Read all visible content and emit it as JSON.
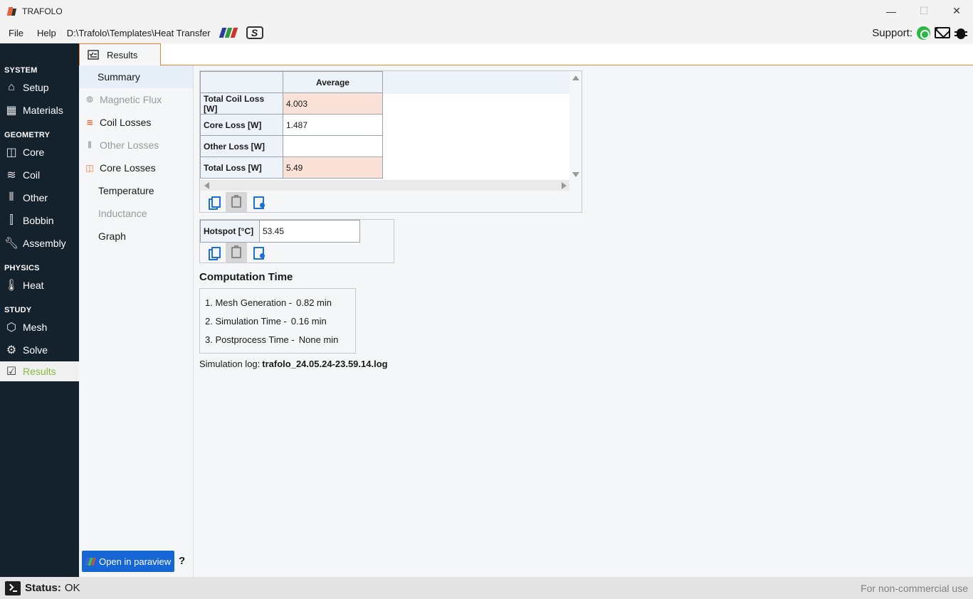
{
  "window": {
    "title": "TRAFOLO",
    "minimize": "—",
    "maximize": "☐",
    "close": "✕"
  },
  "menu": {
    "file": "File",
    "help": "Help",
    "path": "D:\\Trafolo\\Templates\\Heat Transfer",
    "support_label": "Support:"
  },
  "tabs": [
    {
      "label": "Results",
      "icon": "results-icon"
    }
  ],
  "sidebar": {
    "sections": [
      {
        "title": "SYSTEM",
        "items": [
          {
            "label": "Setup",
            "icon": "home-icon"
          },
          {
            "label": "Materials",
            "icon": "materials-icon"
          }
        ]
      },
      {
        "title": "GEOMETRY",
        "items": [
          {
            "label": "Core",
            "icon": "core-icon"
          },
          {
            "label": "Coil",
            "icon": "coil-icon"
          },
          {
            "label": "Other",
            "icon": "other-icon"
          },
          {
            "label": "Bobbin",
            "icon": "bobbin-icon"
          },
          {
            "label": "Assembly",
            "icon": "wrench-icon"
          }
        ]
      },
      {
        "title": "PHYSICS",
        "items": [
          {
            "label": "Heat",
            "icon": "thermometer-icon"
          }
        ]
      },
      {
        "title": "STUDY",
        "items": [
          {
            "label": "Mesh",
            "icon": "mesh-icon"
          },
          {
            "label": "Solve",
            "icon": "solve-icon"
          },
          {
            "label": "Results",
            "icon": "results-icon",
            "active": true
          }
        ]
      }
    ]
  },
  "subnav": {
    "items": [
      {
        "label": "Summary",
        "selected": true
      },
      {
        "label": "Magnetic Flux",
        "enabled": false,
        "icon": "magnetic-flux-icon"
      },
      {
        "label": "Coil Losses",
        "enabled": true,
        "icon": "coil-losses-icon"
      },
      {
        "label": "Other Losses",
        "enabled": false,
        "icon": "other-losses-icon"
      },
      {
        "label": "Core Losses",
        "enabled": true,
        "icon": "core-losses-icon"
      },
      {
        "label": "Temperature"
      },
      {
        "label": "Inductance",
        "enabled": false
      },
      {
        "label": "Graph"
      }
    ],
    "paraview_button": "Open in paraview",
    "help": "?"
  },
  "loss_table": {
    "column_header": "Average",
    "rows": [
      {
        "label": "Total Coil Loss [W]",
        "value": "4.003",
        "highlight": true
      },
      {
        "label": "Core Loss [W]",
        "value": "1.487",
        "highlight": false
      },
      {
        "label": "Other Loss [W]",
        "value": "",
        "highlight": false
      },
      {
        "label": "Total Loss [W]",
        "value": "5.49",
        "highlight": true
      }
    ]
  },
  "hotspot": {
    "label": "Hotspot [°C]",
    "value": "53.45"
  },
  "computation": {
    "title": "Computation Time",
    "lines": [
      {
        "label": "1. Mesh Generation -",
        "value": "0.82 min"
      },
      {
        "label": "2. Simulation Time -",
        "value": "0.16 min"
      },
      {
        "label": "3. Postprocess Time -",
        "value": "None min"
      }
    ]
  },
  "simulation_log": {
    "label": "Simulation log:",
    "file": "trafolo_24.05.24-23.59.14.log"
  },
  "status": {
    "label": "Status:",
    "value": "OK",
    "license": "For non-commercial use"
  },
  "colors": {
    "sidebar_bg": "#14222e",
    "accent_orange": "#e8823c",
    "active_green": "#8cbb3c",
    "highlight_cell": "#fbe2d8",
    "button_blue": "#1766d6"
  }
}
